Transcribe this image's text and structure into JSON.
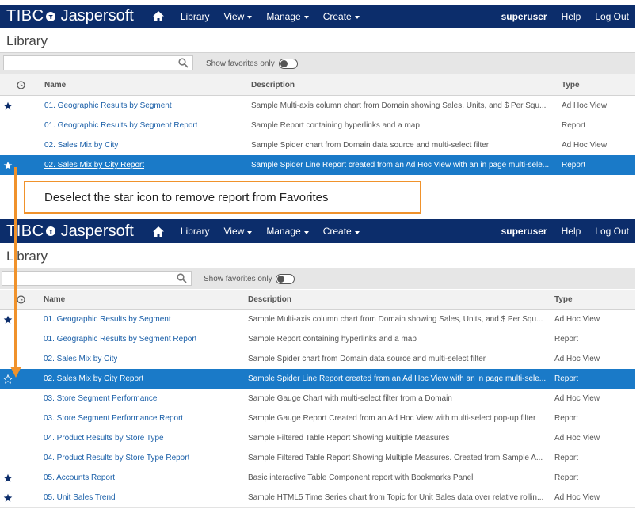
{
  "brand": {
    "tibco": "TIBC",
    "jaspersoft": "Jaspersoft"
  },
  "nav": {
    "library": "Library",
    "view": "View",
    "manage": "Manage",
    "create": "Create",
    "user": "superuser",
    "help": "Help",
    "logout": "Log Out"
  },
  "page_title": "Library",
  "search": {
    "placeholder": ""
  },
  "favorites_toggle": {
    "label": "Show favorites only",
    "state": "off"
  },
  "columns": {
    "name": "Name",
    "description": "Description",
    "type": "Type"
  },
  "callout": {
    "text": "Deselect the star icon to remove report from Favorites"
  },
  "colors": {
    "navbar": "#0c2d6b",
    "selected_row": "#1a7ac8",
    "link": "#1a5fa8",
    "callout_border": "#f0922b",
    "arrow": "#f0922b"
  },
  "top_panel": {
    "rows": [
      {
        "favorite": true,
        "selected": false,
        "name": "01. Geographic Results by Segment",
        "description": "Sample Multi-axis column chart from Domain showing Sales, Units, and $ Per Squ...",
        "type": "Ad Hoc View"
      },
      {
        "favorite": false,
        "selected": false,
        "name": "01. Geographic Results by Segment Report",
        "description": "Sample Report containing hyperlinks and a map",
        "type": "Report"
      },
      {
        "favorite": false,
        "selected": false,
        "name": "02. Sales Mix by City",
        "description": "Sample Spider chart from Domain data source and multi-select filter",
        "type": "Ad Hoc View"
      },
      {
        "favorite": true,
        "selected": true,
        "name": "02. Sales Mix by City Report",
        "description": "Sample Spider Line Report created from an Ad Hoc View with an in page multi-sele...",
        "type": "Report"
      }
    ]
  },
  "bottom_panel": {
    "rows": [
      {
        "favorite": true,
        "selected": false,
        "name": "01. Geographic Results by Segment",
        "description": "Sample Multi-axis column chart from Domain showing Sales, Units, and $ Per Squ...",
        "type": "Ad Hoc View"
      },
      {
        "favorite": false,
        "selected": false,
        "name": "01. Geographic Results by Segment Report",
        "description": "Sample Report containing hyperlinks and a map",
        "type": "Report"
      },
      {
        "favorite": false,
        "selected": false,
        "name": "02. Sales Mix by City",
        "description": "Sample Spider chart from Domain data source and multi-select filter",
        "type": "Ad Hoc View"
      },
      {
        "favorite": false,
        "selected": true,
        "name": "02. Sales Mix by City Report",
        "description": "Sample Spider Line Report created from an Ad Hoc View with an in page multi-sele...",
        "type": "Report"
      },
      {
        "favorite": false,
        "selected": false,
        "name": "03. Store Segment Performance",
        "description": "Sample Gauge Chart with multi-select filter from a Domain",
        "type": "Ad Hoc View"
      },
      {
        "favorite": false,
        "selected": false,
        "name": "03. Store Segment Performance Report",
        "description": "Sample Gauge Report Created from an Ad Hoc View with multi-select pop-up filter",
        "type": "Report"
      },
      {
        "favorite": false,
        "selected": false,
        "name": "04. Product Results by Store Type",
        "description": "Sample Filtered Table Report Showing Multiple Measures",
        "type": "Ad Hoc View"
      },
      {
        "favorite": false,
        "selected": false,
        "name": "04. Product Results by Store Type Report",
        "description": "Sample Filtered Table Report Showing Multiple Measures. Created from Sample A...",
        "type": "Report"
      },
      {
        "favorite": true,
        "selected": false,
        "name": "05. Accounts Report",
        "description": "Basic interactive Table Component report with Bookmarks Panel",
        "type": "Report"
      },
      {
        "favorite": true,
        "selected": false,
        "name": "05. Unit Sales Trend",
        "description": "Sample HTML5 Time Series chart from Topic for Unit Sales data over relative rollin...",
        "type": "Ad Hoc View"
      }
    ]
  }
}
